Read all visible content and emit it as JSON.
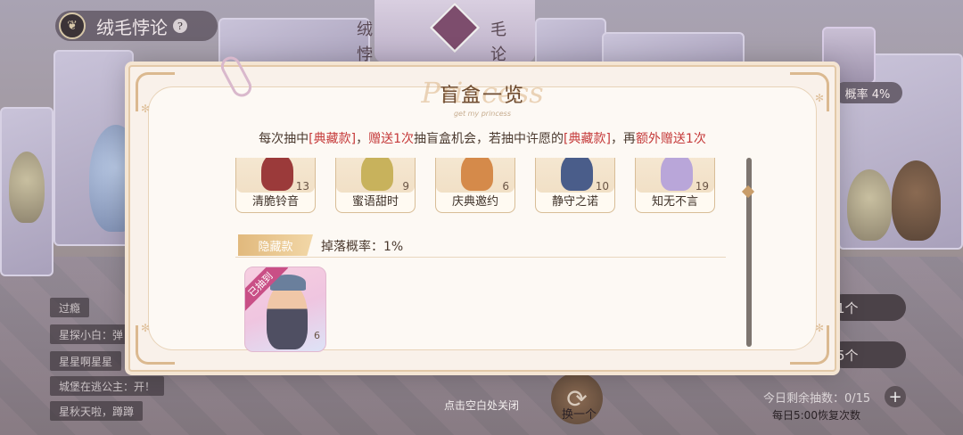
{
  "background": {
    "game_title": "绒毛悖论",
    "emblem_glyph": "❦",
    "help_glyph": "?",
    "banner_left_chars": [
      "绒",
      "悖"
    ],
    "banner_right_chars": [
      "毛",
      "论"
    ],
    "rate_badge": "概率 4%",
    "chat_messages": [
      "过瘾",
      "星探小白：弹",
      "星星啊星星",
      "城堡在逃公主：开！",
      "星秋天啦，蹲蹲"
    ],
    "draw_options": [
      "1个",
      "5个"
    ],
    "remaining_draws": "今日剩余抽数：0/15",
    "add_glyph": "+",
    "restore_text": "每日5:00恢复次数",
    "swap_glyph": "⟳",
    "swap_label": "换一个"
  },
  "modal": {
    "title": "盲盒一览",
    "title_script": "Princess",
    "title_sub": "get my princess",
    "rule": {
      "p1": "每次抽中",
      "p2": "[典藏款]",
      "p3": "，",
      "p4": "赠送1次",
      "p5": "抽盲盒机会，若抽中许愿的",
      "p6": "[典藏款]",
      "p7": "，再",
      "p8": "额外赠送1次"
    },
    "cards": [
      {
        "name": "清脆铃音",
        "count": "13",
        "color": "#9b3a3a"
      },
      {
        "name": "蜜语甜时",
        "count": "9",
        "color": "#c8b25c"
      },
      {
        "name": "庆典邀约",
        "count": "6",
        "color": "#d58a4a"
      },
      {
        "name": "静守之诺",
        "count": "10",
        "color": "#4a5d8a"
      },
      {
        "name": "知无不言",
        "count": "19",
        "color": "#b9a6d9"
      }
    ],
    "hidden_tier": {
      "tag": "隐藏款",
      "rate": "掉落概率：1%",
      "card_ribbon": "已抽到",
      "card_count": "6"
    }
  },
  "close_hint": "点击空白处关闭"
}
